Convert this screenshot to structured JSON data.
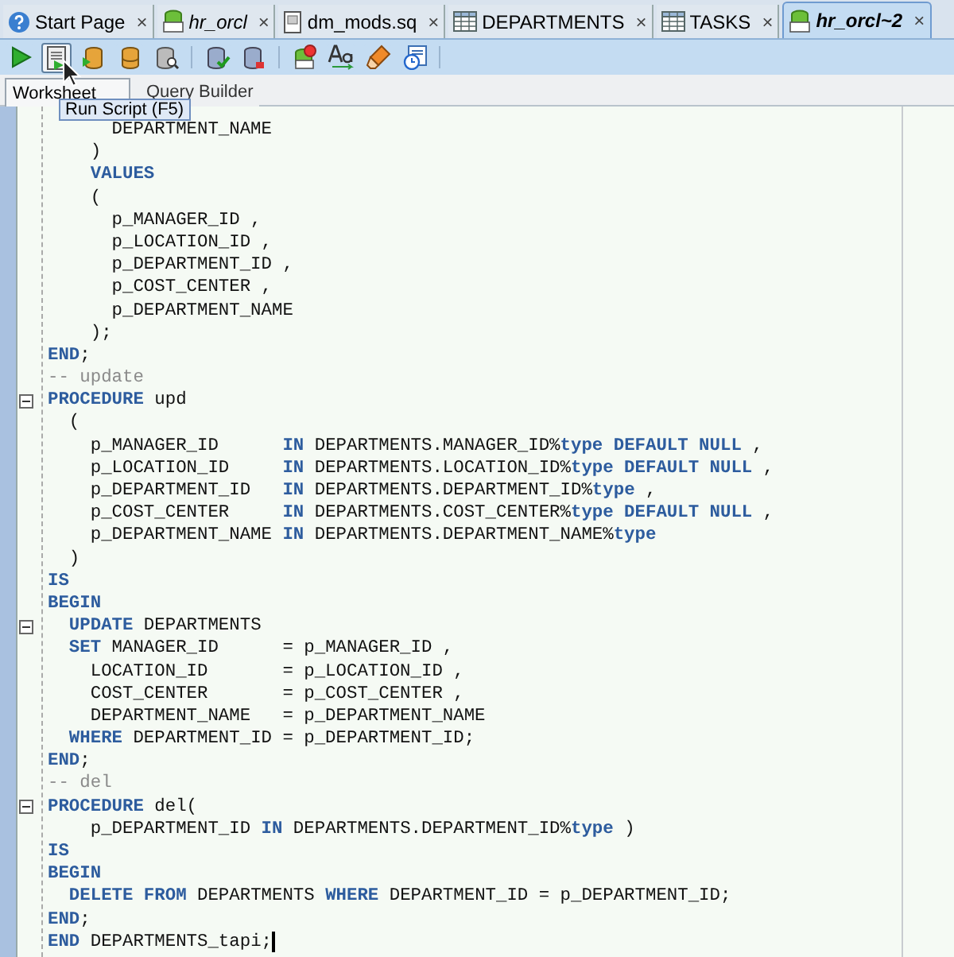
{
  "tabs": [
    {
      "label": "Start Page",
      "kind": "help",
      "selected": false
    },
    {
      "label": "hr_orcl",
      "kind": "sql",
      "selected": false
    },
    {
      "label": "dm_mods.sq",
      "kind": "file",
      "selected": false
    },
    {
      "label": "DEPARTMENTS",
      "kind": "table",
      "selected": false
    },
    {
      "label": "TASKS",
      "kind": "table",
      "selected": false
    },
    {
      "label": "hr_orcl~2",
      "kind": "sql",
      "selected": true
    }
  ],
  "close_glyph": "×",
  "toolbar": [
    {
      "kind": "run",
      "hovered": false
    },
    {
      "kind": "script",
      "hovered": true
    },
    {
      "kind": "autotrace",
      "hovered": false
    },
    {
      "kind": "explain",
      "hovered": false
    },
    {
      "kind": "tuning",
      "hovered": false
    },
    {
      "kind": "separator"
    },
    {
      "kind": "commit",
      "hovered": false
    },
    {
      "kind": "rollback",
      "hovered": false
    },
    {
      "kind": "separator"
    },
    {
      "kind": "unshared",
      "hovered": false
    },
    {
      "kind": "case",
      "hovered": false
    },
    {
      "kind": "clear",
      "hovered": false
    },
    {
      "kind": "history",
      "hovered": false
    },
    {
      "kind": "separator"
    }
  ],
  "tooltip": "Run Script (F5)",
  "subtabs": [
    {
      "label": "Worksheet",
      "selected": true
    },
    {
      "label": "Query Builder",
      "selected": false
    }
  ],
  "code": [
    {
      "fold": false,
      "tokens": [
        {
          "kind": "plain",
          "text": "      DEPARTMENT_NAME"
        }
      ]
    },
    {
      "fold": false,
      "tokens": [
        {
          "kind": "plain",
          "text": "    )"
        }
      ]
    },
    {
      "fold": false,
      "tokens": [
        {
          "kind": "kw",
          "text": "    VALUES"
        }
      ]
    },
    {
      "fold": false,
      "tokens": [
        {
          "kind": "plain",
          "text": "    ("
        }
      ]
    },
    {
      "fold": false,
      "tokens": [
        {
          "kind": "plain",
          "text": "      p_MANAGER_ID ,"
        }
      ]
    },
    {
      "fold": false,
      "tokens": [
        {
          "kind": "plain",
          "text": "      p_LOCATION_ID ,"
        }
      ]
    },
    {
      "fold": false,
      "tokens": [
        {
          "kind": "plain",
          "text": "      p_DEPARTMENT_ID ,"
        }
      ]
    },
    {
      "fold": false,
      "tokens": [
        {
          "kind": "plain",
          "text": "      p_COST_CENTER ,"
        }
      ]
    },
    {
      "fold": false,
      "tokens": [
        {
          "kind": "plain",
          "text": "      p_DEPARTMENT_NAME"
        }
      ]
    },
    {
      "fold": false,
      "tokens": [
        {
          "kind": "plain",
          "text": "    );"
        }
      ]
    },
    {
      "fold": false,
      "tokens": [
        {
          "kind": "kw",
          "text": "END"
        },
        {
          "kind": "plain",
          "text": ";"
        }
      ]
    },
    {
      "fold": false,
      "tokens": [
        {
          "kind": "comment",
          "text": "-- update"
        }
      ]
    },
    {
      "fold": true,
      "tokens": [
        {
          "kind": "kw",
          "text": "PROCEDURE"
        },
        {
          "kind": "plain",
          "text": " upd"
        }
      ]
    },
    {
      "fold": false,
      "tokens": [
        {
          "kind": "plain",
          "text": "  ("
        }
      ]
    },
    {
      "fold": false,
      "tokens": [
        {
          "kind": "plain",
          "text": "    p_MANAGER_ID      "
        },
        {
          "kind": "kw",
          "text": "IN"
        },
        {
          "kind": "plain",
          "text": " DEPARTMENTS.MANAGER_ID%"
        },
        {
          "kind": "kw",
          "text": "type DEFAULT NULL"
        },
        {
          "kind": "plain",
          "text": " ,"
        }
      ]
    },
    {
      "fold": false,
      "tokens": [
        {
          "kind": "plain",
          "text": "    p_LOCATION_ID     "
        },
        {
          "kind": "kw",
          "text": "IN"
        },
        {
          "kind": "plain",
          "text": " DEPARTMENTS.LOCATION_ID%"
        },
        {
          "kind": "kw",
          "text": "type DEFAULT NULL"
        },
        {
          "kind": "plain",
          "text": " ,"
        }
      ]
    },
    {
      "fold": false,
      "tokens": [
        {
          "kind": "plain",
          "text": "    p_DEPARTMENT_ID   "
        },
        {
          "kind": "kw",
          "text": "IN"
        },
        {
          "kind": "plain",
          "text": " DEPARTMENTS.DEPARTMENT_ID%"
        },
        {
          "kind": "kw",
          "text": "type"
        },
        {
          "kind": "plain",
          "text": " ,"
        }
      ]
    },
    {
      "fold": false,
      "tokens": [
        {
          "kind": "plain",
          "text": "    p_COST_CENTER     "
        },
        {
          "kind": "kw",
          "text": "IN"
        },
        {
          "kind": "plain",
          "text": " DEPARTMENTS.COST_CENTER%"
        },
        {
          "kind": "kw",
          "text": "type DEFAULT NULL"
        },
        {
          "kind": "plain",
          "text": " ,"
        }
      ]
    },
    {
      "fold": false,
      "tokens": [
        {
          "kind": "plain",
          "text": "    p_DEPARTMENT_NAME "
        },
        {
          "kind": "kw",
          "text": "IN"
        },
        {
          "kind": "plain",
          "text": " DEPARTMENTS.DEPARTMENT_NAME%"
        },
        {
          "kind": "kw",
          "text": "type"
        }
      ]
    },
    {
      "fold": false,
      "tokens": [
        {
          "kind": "plain",
          "text": "  )"
        }
      ]
    },
    {
      "fold": false,
      "tokens": [
        {
          "kind": "kw",
          "text": "IS"
        }
      ]
    },
    {
      "fold": false,
      "tokens": [
        {
          "kind": "kw",
          "text": "BEGIN"
        }
      ]
    },
    {
      "fold": true,
      "tokens": [
        {
          "kind": "kw",
          "text": "  UPDATE"
        },
        {
          "kind": "plain",
          "text": " DEPARTMENTS"
        }
      ]
    },
    {
      "fold": false,
      "tokens": [
        {
          "kind": "kw",
          "text": "  SET"
        },
        {
          "kind": "plain",
          "text": " MANAGER_ID      = p_MANAGER_ID ,"
        }
      ]
    },
    {
      "fold": false,
      "tokens": [
        {
          "kind": "plain",
          "text": "    LOCATION_ID       = p_LOCATION_ID ,"
        }
      ]
    },
    {
      "fold": false,
      "tokens": [
        {
          "kind": "plain",
          "text": "    COST_CENTER       = p_COST_CENTER ,"
        }
      ]
    },
    {
      "fold": false,
      "tokens": [
        {
          "kind": "plain",
          "text": "    DEPARTMENT_NAME   = p_DEPARTMENT_NAME"
        }
      ]
    },
    {
      "fold": false,
      "tokens": [
        {
          "kind": "kw",
          "text": "  WHERE"
        },
        {
          "kind": "plain",
          "text": " DEPARTMENT_ID = p_DEPARTMENT_ID;"
        }
      ]
    },
    {
      "fold": false,
      "tokens": [
        {
          "kind": "kw",
          "text": "END"
        },
        {
          "kind": "plain",
          "text": ";"
        }
      ]
    },
    {
      "fold": false,
      "tokens": [
        {
          "kind": "comment",
          "text": "-- del"
        }
      ]
    },
    {
      "fold": true,
      "tokens": [
        {
          "kind": "kw",
          "text": "PROCEDURE"
        },
        {
          "kind": "plain",
          "text": " del("
        }
      ]
    },
    {
      "fold": false,
      "tokens": [
        {
          "kind": "plain",
          "text": "    p_DEPARTMENT_ID "
        },
        {
          "kind": "kw",
          "text": "IN"
        },
        {
          "kind": "plain",
          "text": " DEPARTMENTS.DEPARTMENT_ID%"
        },
        {
          "kind": "kw",
          "text": "type"
        },
        {
          "kind": "plain",
          "text": " )"
        }
      ]
    },
    {
      "fold": false,
      "tokens": [
        {
          "kind": "kw",
          "text": "IS"
        }
      ]
    },
    {
      "fold": false,
      "tokens": [
        {
          "kind": "kw",
          "text": "BEGIN"
        }
      ]
    },
    {
      "fold": false,
      "tokens": [
        {
          "kind": "kw",
          "text": "  DELETE FROM"
        },
        {
          "kind": "plain",
          "text": " DEPARTMENTS "
        },
        {
          "kind": "kw",
          "text": "WHERE"
        },
        {
          "kind": "plain",
          "text": " DEPARTMENT_ID = p_DEPARTMENT_ID;"
        }
      ]
    },
    {
      "fold": false,
      "tokens": [
        {
          "kind": "kw",
          "text": "END"
        },
        {
          "kind": "plain",
          "text": ";"
        }
      ]
    },
    {
      "fold": false,
      "caret": true,
      "tokens": [
        {
          "kind": "kw",
          "text": "END"
        },
        {
          "kind": "plain",
          "text": " DEPARTMENTS_tapi;"
        }
      ]
    }
  ]
}
